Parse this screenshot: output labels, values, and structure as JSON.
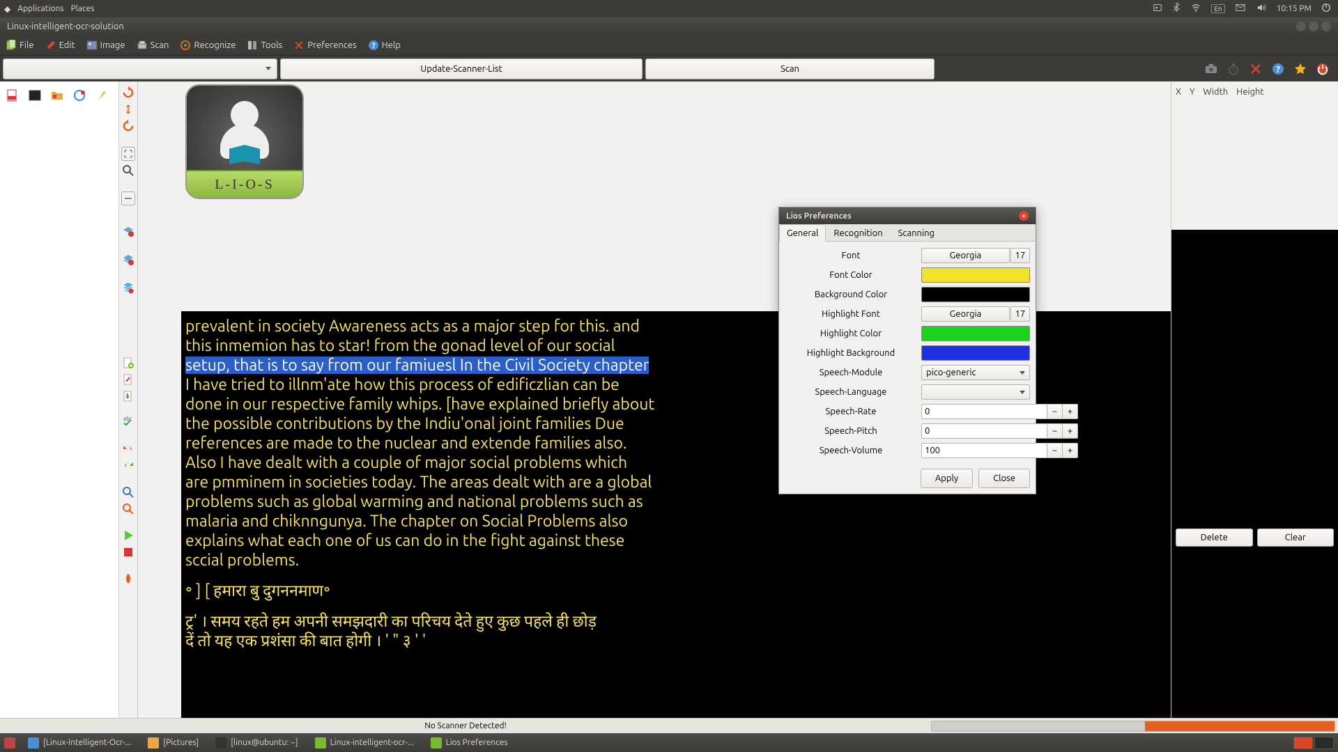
{
  "panel": {
    "applications": "Applications",
    "places": "Places",
    "time": "10:15 PM",
    "kbd": "En"
  },
  "window": {
    "title": "Linux-intelligent-ocr-solution"
  },
  "menu": {
    "file": "File",
    "edit": "Edit",
    "image": "Image",
    "scan": "Scan",
    "recognize": "Recognize",
    "tools": "Tools",
    "preferences": "Preferences",
    "help": "Help"
  },
  "toolbar": {
    "update": "Update-Scanner-List",
    "scan": "Scan"
  },
  "logo_text": "L-I-O-S",
  "coords": {
    "x": "X",
    "y": "Y",
    "w": "Width",
    "h": "Height"
  },
  "buttons": {
    "delete": "Delete",
    "clear": "Clear"
  },
  "ocr": {
    "l1": "prevalent in society Awareness acts as a major step for this. and",
    "l2": "this inmemion has to star! from the gonad level of our social",
    "l3": "setup, that is to say from our famiuesl In the Civil Society chapter",
    "l4": "I have tried to illnm'ate how this process of edificzlian can be",
    "l5": "done in our respective family whips. [have explained briefly about",
    "l6": "the possible contributions by the Indiu'onal joint families Due",
    "l7": "references are made to the nuclear and extende families also.",
    "l8": "Also I have dealt with a couple of major social problems which",
    "l9": "are pmminem in societies today. The areas dealt with are a global",
    "l10": "problems such as global warming and national problems such as",
    "l11": "malaria and chiknngunya. The chapter on Social Problems also",
    "l12": "explains what each one of us can do in the fight against these",
    "l13": "sccial problems.",
    "l14": "॰ ] [ हमारा बु दुगननमाण॰",
    "l15": "ट्र' । समय रहते हम अपनी समझदारी का परिचय देते हुए कुछ पहले ही छोड़",
    "l16": "दें तो यह एक प्रशंसा की बात होगी । ' \" ३ ' '"
  },
  "dialog": {
    "title": "Lios Preferences",
    "tabs": {
      "general": "General",
      "recognition": "Recognition",
      "scanning": "Scanning"
    },
    "labels": {
      "font": "Font",
      "font_color": "Font Color",
      "bg_color": "Background Color",
      "hl_font": "Highlight Font",
      "hl_color": "Highlight Color",
      "hl_bg": "Highlight Background",
      "speech_module": "Speech-Module",
      "speech_lang": "Speech-Language",
      "speech_rate": "Speech-Rate",
      "speech_pitch": "Speech-Pitch",
      "speech_vol": "Speech-Volume"
    },
    "values": {
      "font_name": "Georgia",
      "font_size": "17",
      "hl_font_name": "Georgia",
      "hl_font_size": "17",
      "speech_module": "pico-generic",
      "speech_lang": "",
      "rate": "0",
      "pitch": "0",
      "volume": "100"
    },
    "colors": {
      "font": "#f2e22b",
      "bg": "#000000",
      "hl": "#1bd31b",
      "hl_bg": "#1f2fe2"
    },
    "apply": "Apply",
    "close": "Close"
  },
  "status": "No Scanner Detected!",
  "taskbar": {
    "t1": "[Linux-Intelligent-Ocr-...",
    "t2": "[Pictures]",
    "t3": "[linux@ubuntu: ~]",
    "t4": "Linux-intelligent-ocr-...",
    "t5": "Lios Preferences"
  }
}
